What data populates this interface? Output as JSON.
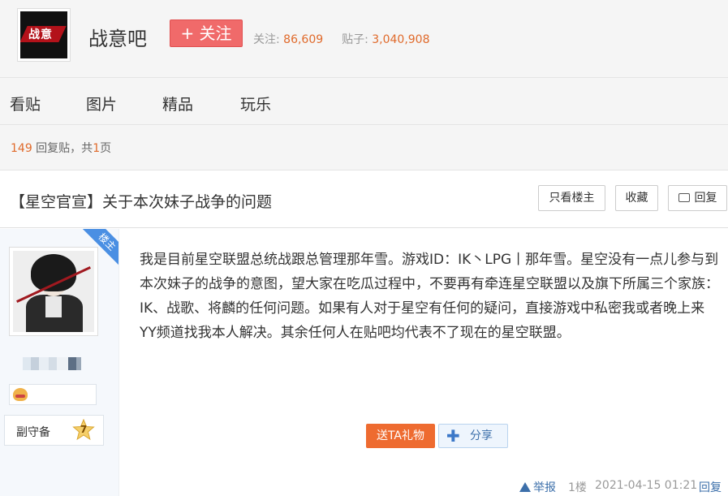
{
  "header": {
    "logo_text": "战意",
    "forum_name": "战意吧",
    "follow_label": "+ 关注",
    "followers_label": "关注:",
    "followers_value": "86,609",
    "posts_label": "贴子:",
    "posts_value": "3,040,908"
  },
  "nav": {
    "items": [
      "看贴",
      "图片",
      "精品",
      "玩乐"
    ]
  },
  "reply_info": {
    "count": "149",
    "mid": " 回复贴，共",
    "pages": "1",
    "suffix": "页"
  },
  "thread": {
    "title": "【星空官宣】关于本次妹子战争的问题",
    "only_op_label": "只看楼主",
    "favorite_label": "收藏",
    "reply_label": "回复"
  },
  "author": {
    "owner_badge": "楼主",
    "rank_label": "副守备",
    "rank_level": "7"
  },
  "post": {
    "content": "我是目前星空联盟总统战跟总管理那年雪。游戏ID：IK丶LPG丨那年雪。星空没有一点儿参与到本次妹子的战争的意图，望大家在吃瓜过程中，不要再有牵连星空联盟以及旗下所属三个家族：IK、战歌、将麟的任何问题。如果有人对于星空有任何的疑问，直接游戏中私密我或者晚上来YY频道找我本人解决。其余任何人在贴吧均代表不了现在的星空联盟。",
    "gift_label": "送TA礼物",
    "share_label": "分享",
    "report_label": "举报",
    "floor": "1楼",
    "time": "2021-04-15 01:21",
    "reply_label": "回复"
  },
  "colors": {
    "accent_orange": "#e06a2b",
    "follow_red": "#f06a6a",
    "link_blue": "#3c6faa",
    "ribbon_blue": "#4a8fe3"
  }
}
